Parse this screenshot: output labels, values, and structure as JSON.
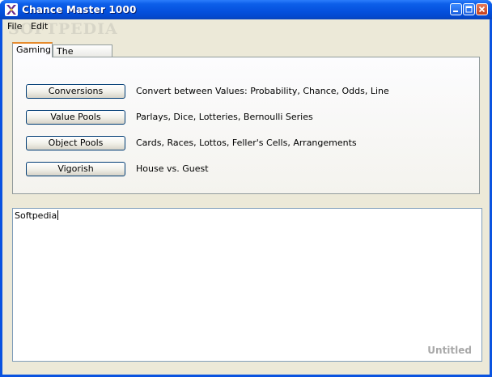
{
  "window": {
    "title": "Chance Master 1000",
    "watermark": "SOFTPEDIA"
  },
  "menu": {
    "items": [
      {
        "label": "File"
      },
      {
        "label": "Edit"
      }
    ]
  },
  "tabs": [
    {
      "label": "Gaming",
      "active": true
    },
    {
      "label": "The Sciences",
      "active": false
    }
  ],
  "gaming": {
    "rows": [
      {
        "button": "Conversions",
        "description": "Convert between Values: Probability, Chance, Odds, Line"
      },
      {
        "button": "Value Pools",
        "description": "Parlays, Dice, Lotteries, Bernoulli Series"
      },
      {
        "button": "Object Pools",
        "description": "Cards, Races, Lottos, Feller's Cells, Arrangements"
      },
      {
        "button": "Vigorish",
        "description": "House vs. Guest"
      }
    ]
  },
  "editor": {
    "content": "Softpedia",
    "document_name": "Untitled"
  }
}
